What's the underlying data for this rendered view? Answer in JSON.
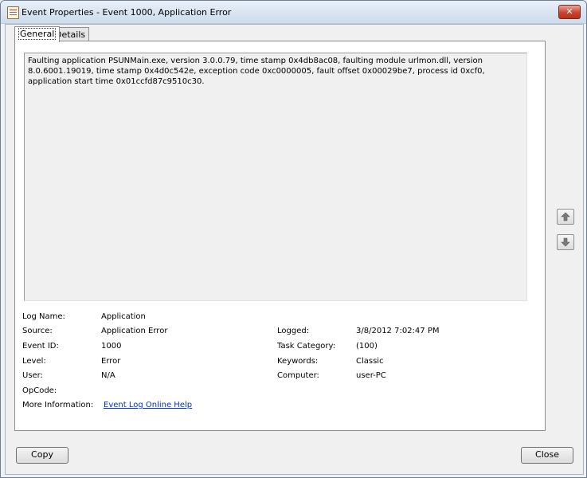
{
  "window": {
    "title": "Event Properties - Event 1000, Application Error",
    "close_glyph": "✕"
  },
  "tabs": [
    {
      "label": "General"
    },
    {
      "label": "Details"
    }
  ],
  "description": "Faulting application PSUNMain.exe, version 3.0.0.79, time stamp 0x4db8ac08, faulting module urlmon.dll, version 8.0.6001.19019, time stamp 0x4d0c542e, exception code 0xc0000005, fault offset 0x00029be7, process id 0xcf0, application start time 0x01ccfd87c9510c30.",
  "fields": {
    "log_name": {
      "label": "Log Name:",
      "value": "Application"
    },
    "source": {
      "label": "Source:",
      "value": "Application Error"
    },
    "event_id": {
      "label": "Event ID:",
      "value": "1000"
    },
    "level": {
      "label": "Level:",
      "value": "Error"
    },
    "user": {
      "label": "User:",
      "value": "N/A"
    },
    "opcode": {
      "label": "OpCode:",
      "value": ""
    },
    "more_info": {
      "label": "More Information:",
      "link": "Event Log Online Help"
    },
    "logged": {
      "label": "Logged:",
      "value": "3/8/2012 7:02:47 PM"
    },
    "task_category": {
      "label": "Task Category:",
      "value": "(100)"
    },
    "keywords": {
      "label": "Keywords:",
      "value": "Classic"
    },
    "computer": {
      "label": "Computer:",
      "value": "user-PC"
    }
  },
  "icons": {
    "window": "event-viewer-icon",
    "up": "arrow-up-icon",
    "down": "arrow-down-icon"
  },
  "buttons": {
    "copy": "Copy",
    "close": "Close"
  },
  "colors": {
    "link": "#0033cc",
    "close_button": "#c9432f"
  }
}
